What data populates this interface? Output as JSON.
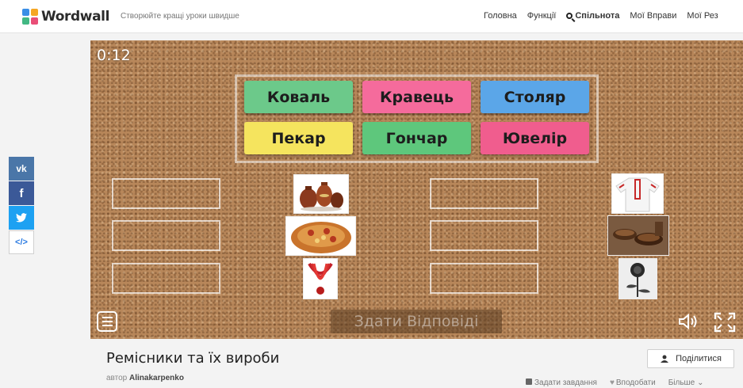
{
  "header": {
    "logo_text": "Wordwall",
    "tagline": "Створюйте кращі уроки швидше",
    "nav": [
      "Головна",
      "Функції",
      "Спільнота",
      "Мої Вправи",
      "Мої Рез"
    ]
  },
  "social": [
    "VK",
    "f",
    "twitter",
    "</>"
  ],
  "game": {
    "timer": "0:12",
    "words": [
      "Коваль",
      "Кравець",
      "Столяр",
      "Пекар",
      "Гончар",
      "Ювелір"
    ],
    "word_colors": [
      "#6cc98a",
      "#f56b9c",
      "#5ba6e8",
      "#f5e45e",
      "#5ec77c",
      "#f05d8e"
    ],
    "images_left": [
      "pottery-image",
      "bread-korovai-image",
      "coral-necklace-image"
    ],
    "images_right": [
      "embroidered-shirt-image",
      "wooden-bowls-image",
      "forged-rose-image"
    ],
    "submit_label": "Здати Відповіді"
  },
  "activity": {
    "title": "Ремісники та їх вироби",
    "author_prefix": "автор",
    "author": "Alinakarpenko",
    "share_label": "Поділитися",
    "actions": [
      "Задати завдання",
      "Вподобати",
      "Більше"
    ]
  }
}
